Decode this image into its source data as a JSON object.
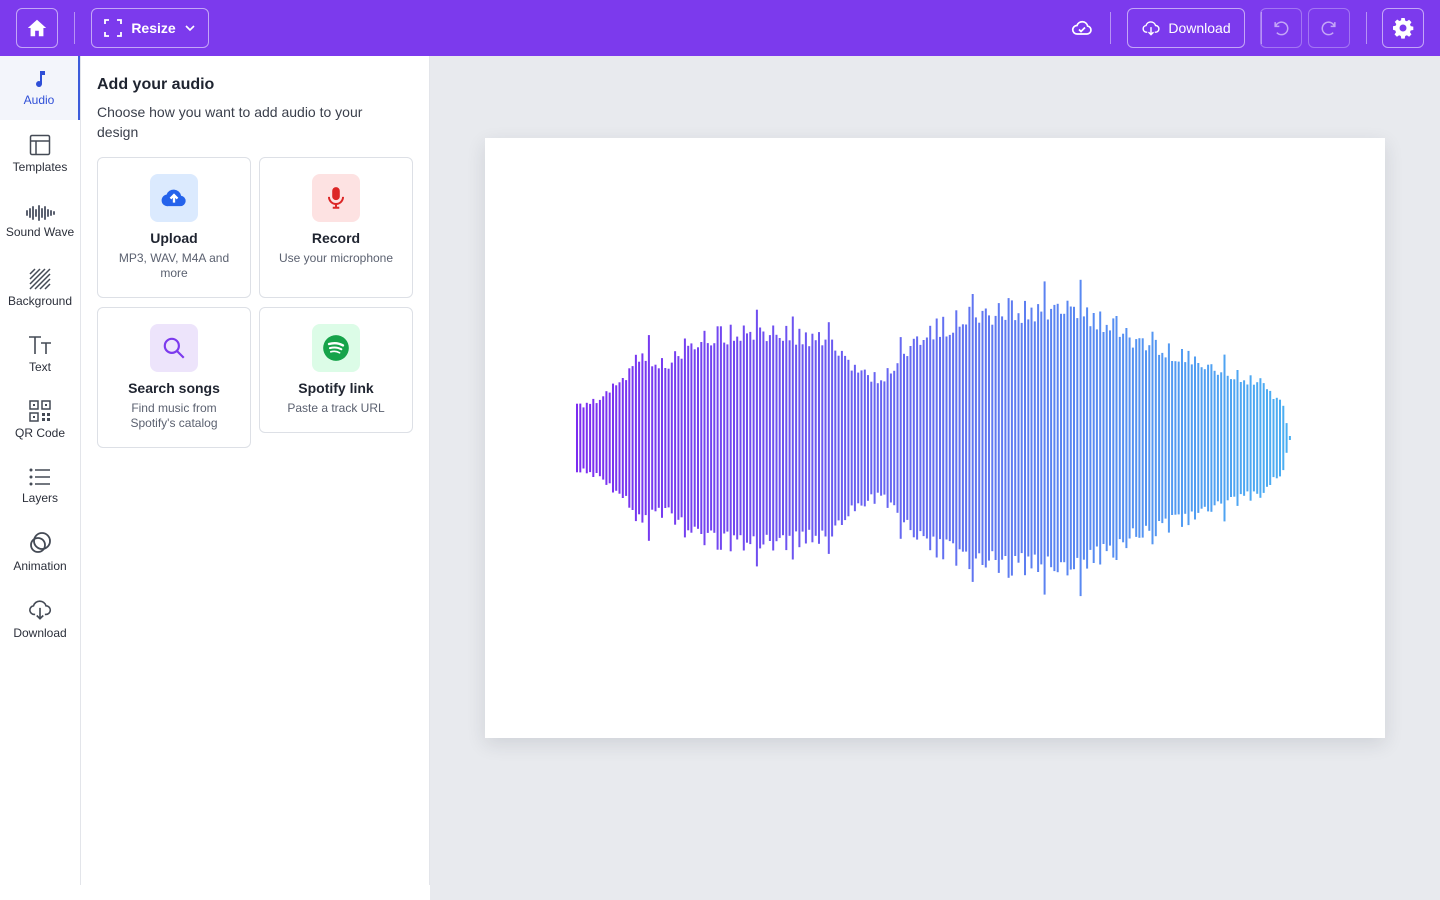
{
  "topbar": {
    "resize_label": "Resize",
    "download_label": "Download"
  },
  "rail": {
    "items": [
      {
        "label": "Audio"
      },
      {
        "label": "Templates"
      },
      {
        "label": "Sound Wave"
      },
      {
        "label": "Background"
      },
      {
        "label": "Text"
      },
      {
        "label": "QR Code"
      },
      {
        "label": "Layers"
      },
      {
        "label": "Animation"
      },
      {
        "label": "Download"
      }
    ]
  },
  "panel": {
    "title": "Add your audio",
    "subtitle": "Choose how you want to add audio to your design",
    "cards": [
      {
        "title": "Upload",
        "desc": "MP3, WAV, M4A and more",
        "icon": "cloud-upload-icon"
      },
      {
        "title": "Record",
        "desc": "Use your microphone",
        "icon": "microphone-icon"
      },
      {
        "title": "Search songs",
        "desc": "Find music from Spotify's catalog",
        "icon": "search-icon"
      },
      {
        "title": "Spotify link",
        "desc": "Paste a track URL",
        "icon": "spotify-icon"
      }
    ]
  },
  "colors": {
    "topbar": "#7c3aed",
    "wave_start": "#7c2cf0",
    "wave_end": "#4ab0f2",
    "active_blue": "#2f4fd7"
  }
}
